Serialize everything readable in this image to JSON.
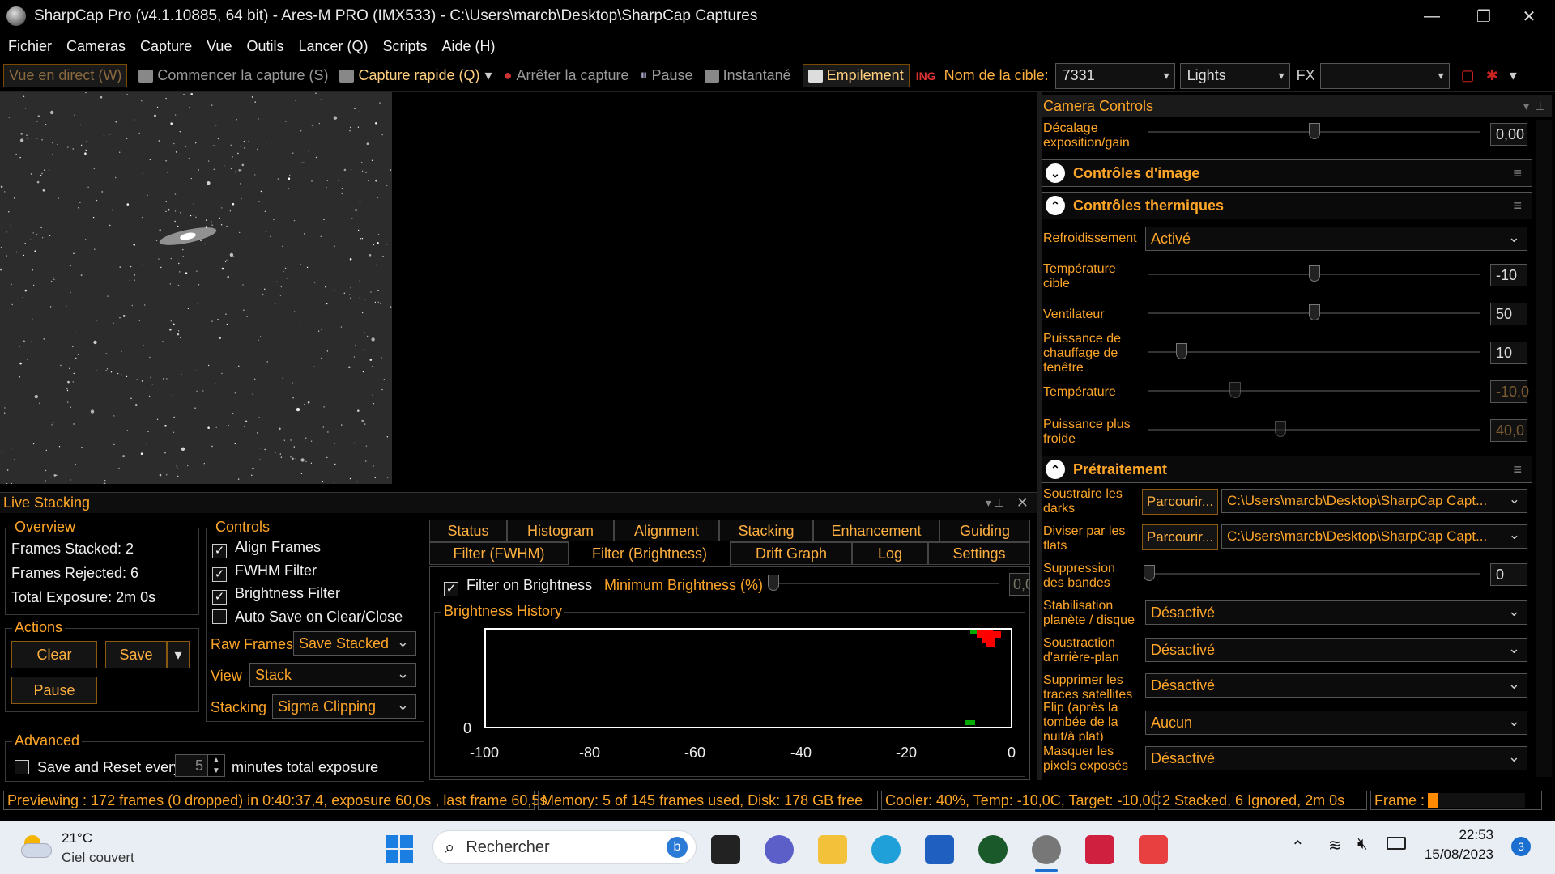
{
  "window": {
    "title": "SharpCap Pro (v4.1.10885, 64 bit) - Ares-M PRO (IMX533) - C:\\Users\\marcb\\Desktop\\SharpCap Captures",
    "minimize": "—",
    "restore": "❐",
    "close": "✕"
  },
  "menu": [
    "Fichier",
    "Cameras",
    "Capture",
    "Vue",
    "Outils",
    "Lancer (Q)",
    "Scripts",
    "Aide (H)"
  ],
  "toolbar": {
    "live_view": "Vue en direct (W)",
    "start_capture": "Commencer la capture (S)",
    "quick_capture": "Capture rapide (Q)",
    "stop_capture": "Arrêter la capture",
    "pause": "Pause",
    "snapshot": "Instantané",
    "stacking": "Empilement",
    "target_label": "Nom de la cible:",
    "target_value": "7331",
    "frame_type": "Lights",
    "fx_label": "FX",
    "fx_value": ""
  },
  "live_stacking": {
    "header": "Live Stacking",
    "overview": {
      "label": "Overview",
      "frames_stacked": "Frames Stacked:  2",
      "frames_rejected": "Frames Rejected: 6",
      "total_exposure": "Total Exposure:    2m 0s"
    },
    "actions": {
      "label": "Actions",
      "clear": "Clear",
      "save": "Save",
      "pause": "Pause"
    },
    "controls": {
      "label": "Controls",
      "align_frames": "Align Frames",
      "fwhm_filter": "FWHM Filter",
      "brightness_filter": "Brightness Filter",
      "auto_save": "Auto Save on Clear/Close",
      "raw_frames_label": "Raw Frames",
      "raw_frames_value": "Save Stacked",
      "view_label": "View",
      "view_value": "Stack",
      "stacking_label": "Stacking",
      "stacking_value": "Sigma Clipping"
    },
    "advanced": {
      "label": "Advanced",
      "save_reset": "Save and Reset every",
      "minutes_value": "5",
      "minutes_label": "minutes total exposure"
    },
    "tabs_row1": [
      "Status",
      "Histogram",
      "Alignment",
      "Stacking",
      "Enhancement",
      "Guiding"
    ],
    "tabs_row2": [
      "Filter (FWHM)",
      "Filter (Brightness)",
      "Drift Graph",
      "Log",
      "Settings"
    ],
    "filter": {
      "filter_on_brightness": "Filter on Brightness",
      "min_brightness_label": "Minimum Brightness (%)",
      "min_brightness_value": "0,0",
      "history_label": "Brightness History",
      "y_zero": "0",
      "x_ticks": [
        "-100",
        "-80",
        "-60",
        "-40",
        "-20",
        "0"
      ]
    }
  },
  "camera_controls": {
    "header": "Camera Controls",
    "decalage_label": "Décalage exposition/gain",
    "decalage_value": "0,00",
    "image_section": "Contrôles d'image",
    "thermal_section": "Contrôles thermiques",
    "cooling_label": "Refroidissement",
    "cooling_value": "Activé",
    "target_temp_label": "Température cible",
    "target_temp_value": "-10",
    "fan_label": "Ventilateur",
    "fan_value": "50",
    "heater_label": "Puissance de chauffage de fenêtre",
    "heater_value": "10",
    "temp_label": "Température",
    "temp_value": "-10,0",
    "cold_power_label": "Puissance plus froide",
    "cold_power_value": "40,0",
    "preprocess_section": "Prétraitement",
    "darks_label": "Soustraire les darks",
    "browse": "Parcourir...",
    "darks_path": "C:\\Users\\marcb\\Desktop\\SharpCap Capt...",
    "flats_label": "Diviser par les flats",
    "flats_path": "C:\\Users\\marcb\\Desktop\\SharpCap Capt...",
    "banding_label": "Suppression des bandes",
    "banding_value": "0",
    "stab_label": "Stabilisation planète / disque",
    "stab_value": "Désactivé",
    "bg_label": "Soustraction d'arrière-plan",
    "bg_value": "Désactivé",
    "sat_label": "Supprimer les traces satellites",
    "sat_value": "Désactivé",
    "flip_label": "Flip (après la tombée de la nuit/à plat)",
    "flip_value": "Aucun",
    "mask_label": "Masquer les pixels exposés",
    "mask_value": "Désactivé"
  },
  "statusbar": {
    "preview": "Previewing : 172 frames (0 dropped) in 0:40:37,4, exposure 60,0s , last frame 60,5s",
    "memory": "Memory: 5 of 145 frames used, Disk: 178 GB free",
    "cooler": "Cooler: 40%, Temp: -10,0C, Target: -10,0C",
    "stacked": "2 Stacked, 6 Ignored, 2m 0s",
    "frame_label": "Frame :",
    "frame_progress": 0.1
  },
  "taskbar": {
    "weather_temp": "21°C",
    "weather_desc": "Ciel couvert",
    "search_placeholder": "Rechercher",
    "time": "22:53",
    "date": "15/08/2023",
    "notif_count": "3"
  },
  "colors": {
    "accent": "#ffa629",
    "background": "#000000",
    "brightness_points": "#ff0000",
    "brightness_accepted": "#00aa00"
  }
}
